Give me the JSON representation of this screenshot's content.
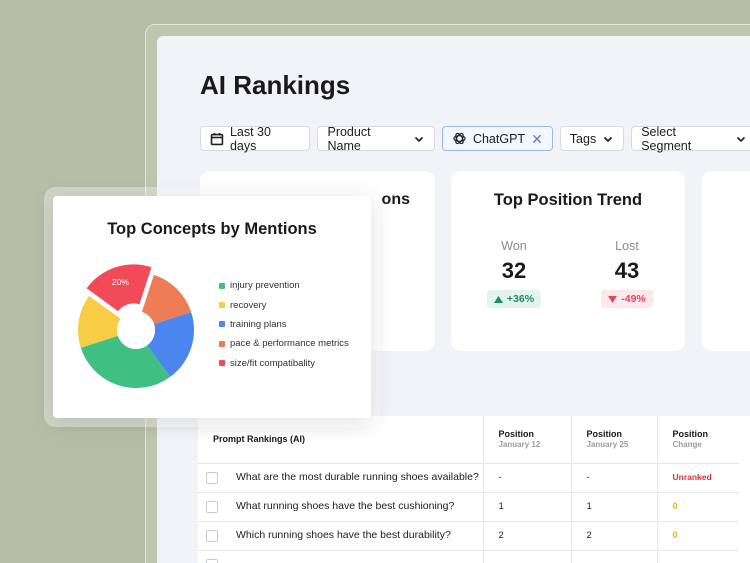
{
  "header": {
    "title": "AI Rankings"
  },
  "filters": {
    "date": "Last 30 days",
    "product": "Product Name",
    "engine": "ChatGPT",
    "tags": "Tags",
    "segment": "Select Segment"
  },
  "cards": {
    "mentions_title_fragment": "ons",
    "trend": {
      "title": "Top Position Trend",
      "won_label": "Won",
      "won_value": "32",
      "won_delta": "+36%",
      "lost_label": "Lost",
      "lost_value": "43",
      "lost_delta": "-49%"
    }
  },
  "table": {
    "headers": [
      {
        "label": "Prompt Rankings (AI)",
        "sub": ""
      },
      {
        "label": "Position",
        "sub": "January 12"
      },
      {
        "label": "Position",
        "sub": "January 25"
      },
      {
        "label": "Position",
        "sub": "Change"
      }
    ],
    "rows": [
      {
        "prompt": "What are the most durable running shoes available?",
        "jan12": "-",
        "jan25": "-",
        "change": "Unranked"
      },
      {
        "prompt": "What running shoes have the best cushioning?",
        "jan12": "1",
        "jan25": "1",
        "change": "0"
      },
      {
        "prompt": "Which running shoes have the best durability?",
        "jan12": "2",
        "jan25": "2",
        "change": "0"
      }
    ]
  },
  "chart_data": {
    "type": "pie",
    "title": "Top Concepts by Mentions",
    "series": [
      {
        "name": "injury prevention",
        "value": 30,
        "color": "#3fbf82"
      },
      {
        "name": "recovery",
        "value": 15,
        "color": "#f7cd45"
      },
      {
        "name": "training plans",
        "value": 20,
        "color": "#4a86ed"
      },
      {
        "name": "pace & performance metrics",
        "value": 15,
        "color": "#ee7d55"
      },
      {
        "name": "size/fit compatibality",
        "value": 20,
        "color": "#f24a58"
      }
    ],
    "data_labels": [
      "",
      "",
      "",
      "",
      "20%"
    ],
    "legend": "right"
  }
}
